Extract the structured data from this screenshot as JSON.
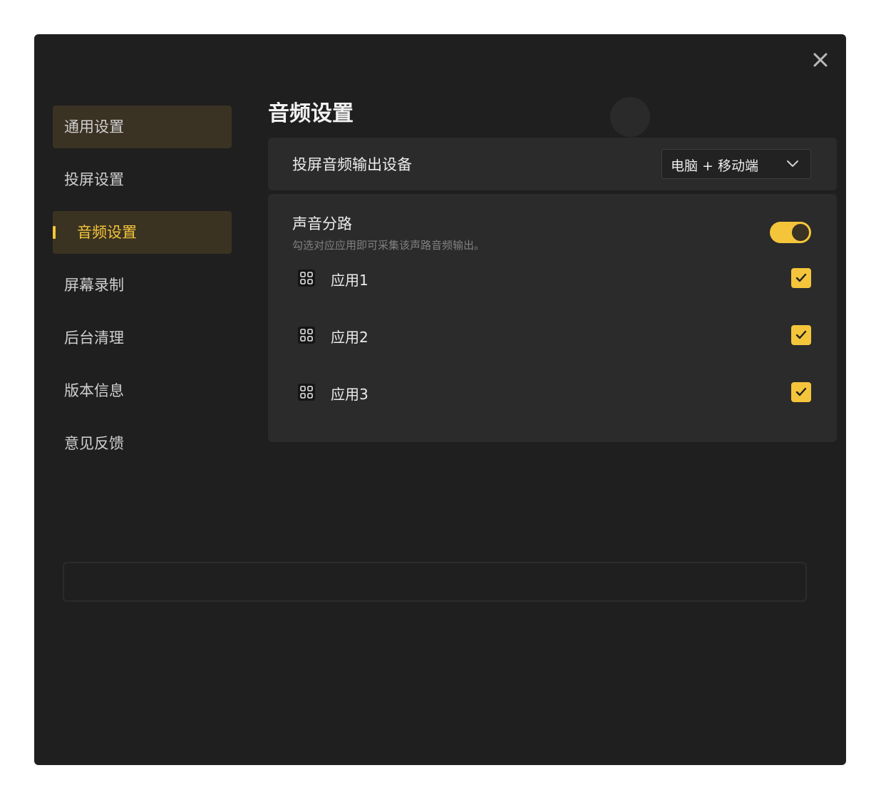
{
  "window": {
    "close_icon": "close-icon"
  },
  "sidebar": {
    "items": [
      {
        "label": "通用设置"
      },
      {
        "label": "投屏设置"
      },
      {
        "label": "音频设置"
      },
      {
        "label": "屏幕录制"
      },
      {
        "label": "后台清理"
      },
      {
        "label": "版本信息"
      },
      {
        "label": "意见反馈"
      }
    ]
  },
  "main": {
    "title": "音频设置",
    "output": {
      "label": "投屏音频输出设备",
      "selected": "电脑 + 移动端"
    },
    "routing": {
      "title": "声音分路",
      "description": "勾选对应应用即可采集该声路音频输出。",
      "enabled": true,
      "apps": [
        {
          "name": "应用1",
          "checked": true
        },
        {
          "name": "应用2",
          "checked": true
        },
        {
          "name": "应用3",
          "checked": true
        }
      ]
    }
  },
  "colors": {
    "accent": "#f4c53b",
    "window_bg": "#1f1f1f",
    "card_bg": "#2b2b2b",
    "active_nav_bg": "#3b3322"
  }
}
